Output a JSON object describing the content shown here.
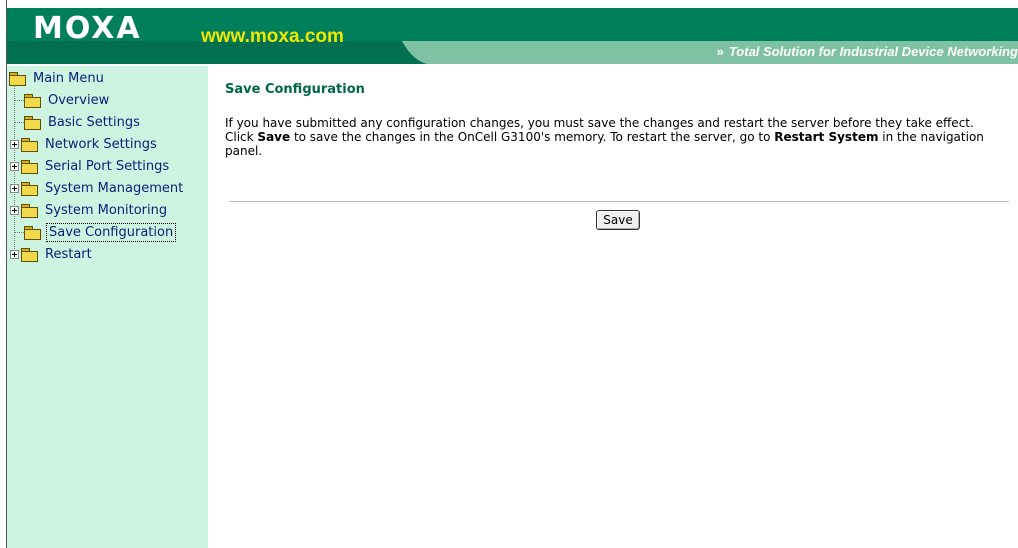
{
  "header": {
    "logo": "MOXA",
    "site": "www.moxa.com",
    "tagline_chevron": "»",
    "tagline": "Total Solution for Industrial Device Networking",
    "colors": {
      "dark": "#00805a",
      "light": "#7fc2a3",
      "site_text": "#f0e600"
    }
  },
  "sidebar": {
    "root": {
      "label": "Main Menu",
      "icon": "open-folder-icon"
    },
    "items": [
      {
        "label": "Overview",
        "expandable": false,
        "icon": "folder-icon"
      },
      {
        "label": "Basic Settings",
        "expandable": false,
        "icon": "folder-icon"
      },
      {
        "label": "Network Settings",
        "expandable": true,
        "icon": "folder-icon"
      },
      {
        "label": "Serial Port Settings",
        "expandable": true,
        "icon": "folder-icon"
      },
      {
        "label": "System Management",
        "expandable": true,
        "icon": "folder-icon"
      },
      {
        "label": "System Monitoring",
        "expandable": true,
        "icon": "folder-icon"
      },
      {
        "label": "Save Configuration",
        "expandable": false,
        "selected": true,
        "icon": "folder-icon"
      },
      {
        "label": "Restart",
        "expandable": true,
        "icon": "folder-icon"
      }
    ]
  },
  "main": {
    "title": "Save Configuration",
    "desc": {
      "line1": "If you have submitted any configuration changes, you must save the changes and restart the server before they take effect.",
      "click": "Click ",
      "save_word": "Save",
      "mid": " to save the changes in the OnCell G3100's memory. To restart the server, go to ",
      "restart_word": "Restart System",
      "end": " in the navigation panel."
    },
    "save_button": "Save"
  }
}
